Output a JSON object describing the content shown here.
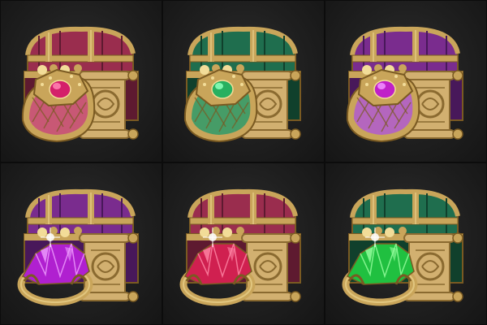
{
  "items": [
    {
      "chest": "#9a2d4e",
      "chestDark": "#5e1a30",
      "ring": "#c84a7a",
      "gem": "#d4206a",
      "gemLight": "#ff7fb0",
      "ringStyle": "band"
    },
    {
      "chest": "#1f6e4e",
      "chestDark": "#10402c",
      "ring": "#2f9a6a",
      "gem": "#28b060",
      "gemLight": "#8affb8",
      "ringStyle": "band"
    },
    {
      "chest": "#7a2c8e",
      "chestDark": "#48185a",
      "ring": "#b05ad0",
      "gem": "#c020c8",
      "gemLight": "#f08cff",
      "ringStyle": "band"
    },
    {
      "chest": "#7a2c8e",
      "chestDark": "#48185a",
      "ring": "#c09040",
      "gem": "#b020d0",
      "gemLight": "#f0a0ff",
      "ringStyle": "crystal"
    },
    {
      "chest": "#9a2d4e",
      "chestDark": "#5e1a30",
      "ring": "#c09040",
      "gem": "#d02050",
      "gemLight": "#ff8aa8",
      "ringStyle": "crystal"
    },
    {
      "chest": "#1f6e4e",
      "chestDark": "#10402c",
      "ring": "#c09040",
      "gem": "#20c040",
      "gemLight": "#9affa0",
      "ringStyle": "crystal"
    }
  ],
  "colors": {
    "gold": "#c9a55a",
    "goldDark": "#7a5a22",
    "goldLight": "#f2dc98",
    "scroll": "#d2b070",
    "scrollDark": "#8a6a30"
  }
}
